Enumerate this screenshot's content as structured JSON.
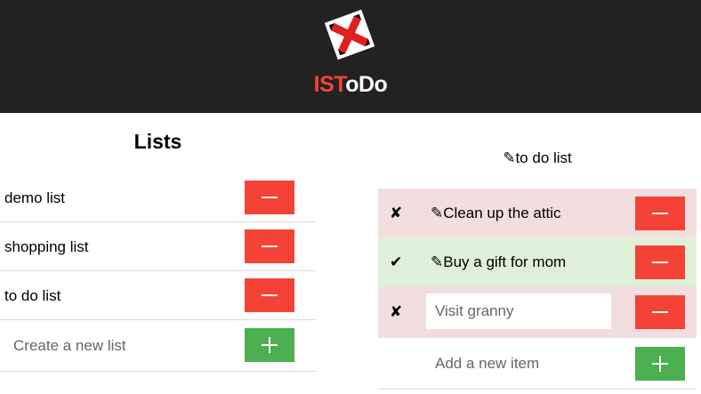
{
  "app": {
    "brand_part1": "IST",
    "brand_part2": "oDo",
    "colors": {
      "header_bg": "#222222",
      "accent_red": "#f44336",
      "accent_green": "#4caf50",
      "pending_row": "#f2dede",
      "done_row": "#dff0d8"
    }
  },
  "lists_panel": {
    "title": "Lists",
    "items": [
      {
        "label": "demo list"
      },
      {
        "label": "shopping list"
      },
      {
        "label": "to do list"
      }
    ],
    "new_list_placeholder": "Create a new list"
  },
  "todo_panel": {
    "title": "✎to do list",
    "items": [
      {
        "status": "✘",
        "text": "✎Clean up the attic",
        "state": "pending"
      },
      {
        "status": "✔",
        "text": "✎Buy a gift for mom",
        "state": "done"
      },
      {
        "status": "✘",
        "edit_value": "Visit granny",
        "state": "pending"
      }
    ],
    "new_item_placeholder": "Add a new item"
  }
}
